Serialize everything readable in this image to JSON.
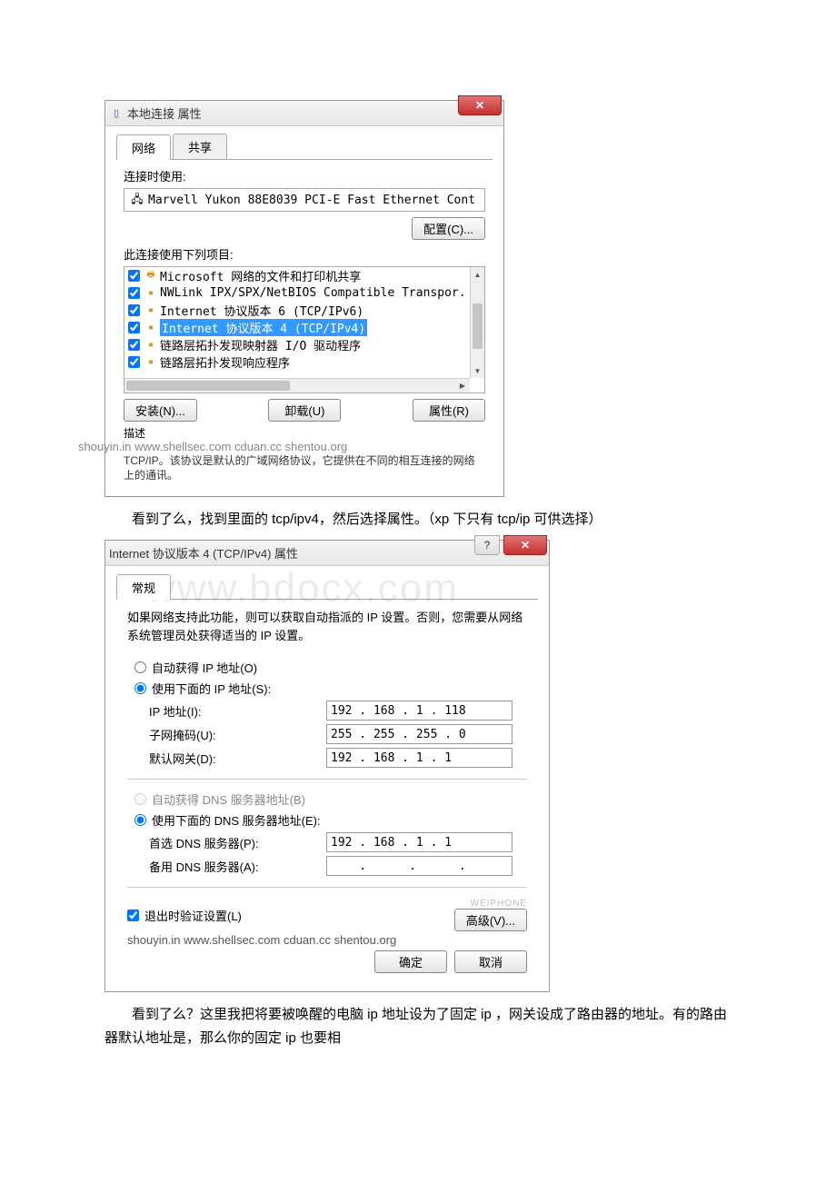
{
  "dialog1": {
    "title": "本地连接 属性",
    "tabs": {
      "network": "网络",
      "share": "共享"
    },
    "connect_label": "连接时使用:",
    "adapter": "Marvell Yukon 88E8039 PCI-E Fast Ethernet Cont",
    "configure_btn": "配置(C)...",
    "items_label": "此连接使用下列项目:",
    "items": [
      "Microsoft 网络的文件和打印机共享",
      "NWLink IPX/SPX/NetBIOS Compatible Transpor.",
      "Internet 协议版本 6 (TCP/IPv6)",
      "Internet 协议版本 4 (TCP/IPv4)",
      "链路层拓扑发现映射器 I/O 驱动程序",
      "链路层拓扑发现响应程序"
    ],
    "install_btn": "安装(N)...",
    "uninstall_btn": "卸载(U)",
    "properties_btn": "属性(R)",
    "desc_label": "描述",
    "desc_text": "shouyin.in www.shellsec.com cduan.cc shentou.org",
    "desc_text2": "TCP/IP。该协议是默认的广域网络协议，它提供在不同的相互连接的网络上的通讯。"
  },
  "para1": "看到了么，找到里面的 tcp/ipv4，然后选择属性。（xp 下只有 tcp/ip 可供选择）",
  "dialog2": {
    "title": "Internet 协议版本 4 (TCP/IPv4) 属性",
    "tab_general": "常规",
    "big_watermark": "www.bdocx.com",
    "instr": "如果网络支持此功能，则可以获取自动指派的 IP 设置。否则，您需要从网络系统管理员处获得适当的 IP 设置。",
    "auto_ip": "自动获得 IP 地址(O)",
    "use_ip": "使用下面的 IP 地址(S):",
    "ip_label": "IP 地址(I):",
    "ip_value": "192 . 168 .  1  . 118",
    "mask_label": "子网掩码(U):",
    "mask_value": "255 . 255 . 255 .  0",
    "gateway_label": "默认网关(D):",
    "gateway_value": "192 . 168 .  1  .  1",
    "auto_dns": "自动获得 DNS 服务器地址(B)",
    "use_dns": "使用下面的 DNS 服务器地址(E):",
    "dns1_label": "首选 DNS 服务器(P):",
    "dns1_value": "192 . 168 .  1  .  1",
    "dns2_label": "备用 DNS 服务器(A):",
    "validate_label": "退出时验证设置(L)",
    "advanced_btn": "高级(V)...",
    "watermark": "shouyin.in www.shellsec.com cduan.cc shentou.org",
    "phone_wm": "WEIPHONE",
    "ok": "确定",
    "cancel": "取消"
  },
  "para2": "看到了么？这里我把将要被唤醒的电脑 ip 地址设为了固定 ip ，网关设成了路由器的地址。有的路由器默认地址是，那么你的固定 ip 也要相"
}
